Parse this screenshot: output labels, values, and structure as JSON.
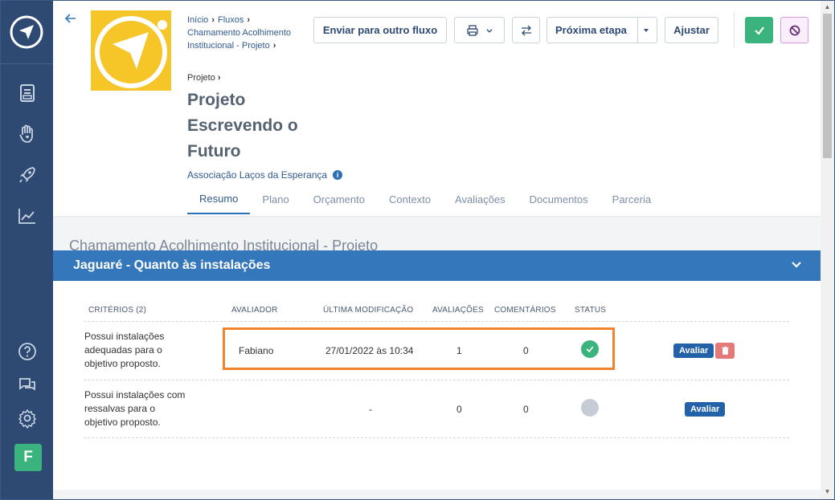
{
  "breadcrumb": {
    "items": [
      "Início",
      "Fluxos",
      "Chamamento Acolhimento Institucional - Projeto"
    ],
    "current": "Projeto"
  },
  "title": "Projeto Escrevendo o Futuro",
  "organization": "Associação Laços da Esperança",
  "tabs": [
    "Resumo",
    "Plano",
    "Orçamento",
    "Contexto",
    "Avaliações",
    "Documentos",
    "Parceria"
  ],
  "toolbar": {
    "send_other_flow": "Enviar para outro fluxo",
    "next_step": "Próxima etapa",
    "adjust": "Ajustar"
  },
  "section_heading": "Chamamento Acolhimento Institucional - Projeto",
  "panel": {
    "title": "Jaguaré - Quanto às instalações",
    "headers": {
      "criteria": "CRITÉRIOS (2)",
      "evaluator": "AVALIADOR",
      "last_modified": "ÚLTIMA MODIFICAÇÃO",
      "evaluations": "AVALIAÇÕES",
      "comments": "COMENTÁRIOS",
      "status": "STATUS"
    },
    "rows": [
      {
        "criterion": "Possui instalações adequadas para o objetivo proposto.",
        "evaluator": "Fabiano",
        "last_modified": "27/01/2022 às 10:34",
        "evaluations": "1",
        "comments": "0",
        "status": "done",
        "action": "Avaliar"
      },
      {
        "criterion": "Possui instalações com ressalvas para o objetivo proposto.",
        "evaluator": "",
        "last_modified": "-",
        "evaluations": "0",
        "comments": "0",
        "status": "pending",
        "action": "Avaliar"
      }
    ]
  },
  "user_initial": "F",
  "colors": {
    "sidebar": "#2e4a73",
    "accent": "#3577bb",
    "success": "#3bb37f",
    "logo_bg": "#f6c528",
    "highlight": "#f0832b"
  }
}
